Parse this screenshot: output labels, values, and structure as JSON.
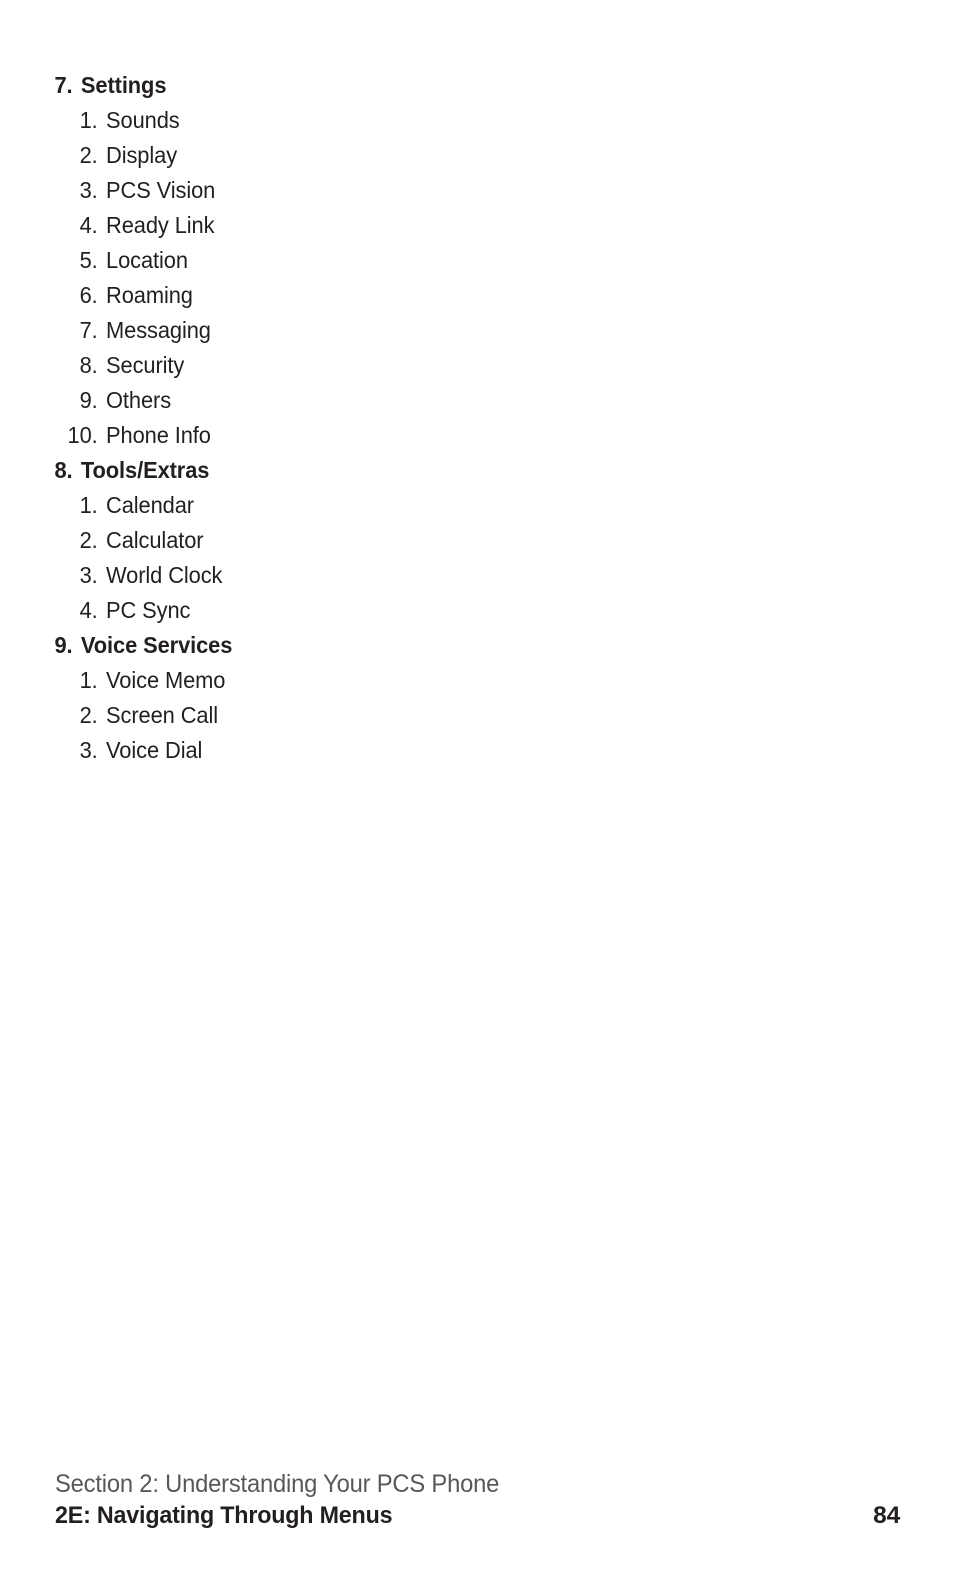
{
  "document": {
    "type": "phone-user-manual-page",
    "page_number": "84"
  },
  "menu_outline": {
    "sections": [
      {
        "number": "7.",
        "title": "Settings",
        "items": [
          {
            "number": "1.",
            "label": "Sounds"
          },
          {
            "number": "2.",
            "label": "Display"
          },
          {
            "number": "3.",
            "label": "PCS Vision"
          },
          {
            "number": "4.",
            "label": "Ready Link"
          },
          {
            "number": "5.",
            "label": "Location"
          },
          {
            "number": "6.",
            "label": "Roaming"
          },
          {
            "number": "7.",
            "label": "Messaging"
          },
          {
            "number": "8.",
            "label": "Security"
          },
          {
            "number": "9.",
            "label": "Others"
          },
          {
            "number": "10.",
            "label": "Phone Info"
          }
        ]
      },
      {
        "number": "8.",
        "title": "Tools/Extras",
        "items": [
          {
            "number": "1.",
            "label": "Calendar"
          },
          {
            "number": "2.",
            "label": "Calculator"
          },
          {
            "number": "3.",
            "label": "World Clock"
          },
          {
            "number": "4.",
            "label": "PC Sync"
          }
        ]
      },
      {
        "number": "9.",
        "title": "Voice Services",
        "items": [
          {
            "number": "1.",
            "label": "Voice Memo"
          },
          {
            "number": "2.",
            "label": "Screen Call"
          },
          {
            "number": "3.",
            "label": "Voice Dial"
          }
        ]
      }
    ]
  },
  "footer": {
    "section_line": "Section 2: Understanding Your PCS Phone",
    "chapter_line": "2E: Navigating Through Menus",
    "page_number": "84"
  },
  "colors": {
    "page_background": "#ffffff",
    "body_text": "#231f20",
    "footer_section_text": "#58585b"
  }
}
